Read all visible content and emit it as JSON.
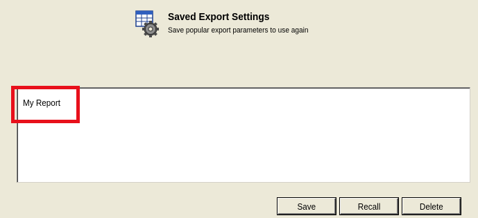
{
  "header": {
    "title": "Saved Export Settings",
    "subtitle": "Save popular export parameters to use again",
    "icon": "table-gear-icon"
  },
  "saved_settings": {
    "items": [
      {
        "label": "My Report",
        "highlighted": true
      }
    ]
  },
  "buttons": {
    "save_label": "Save",
    "recall_label": "Recall",
    "delete_label": "Delete"
  },
  "colors": {
    "background": "#ece9d8",
    "highlight": "#e8101b",
    "list_background": "#ffffff"
  }
}
